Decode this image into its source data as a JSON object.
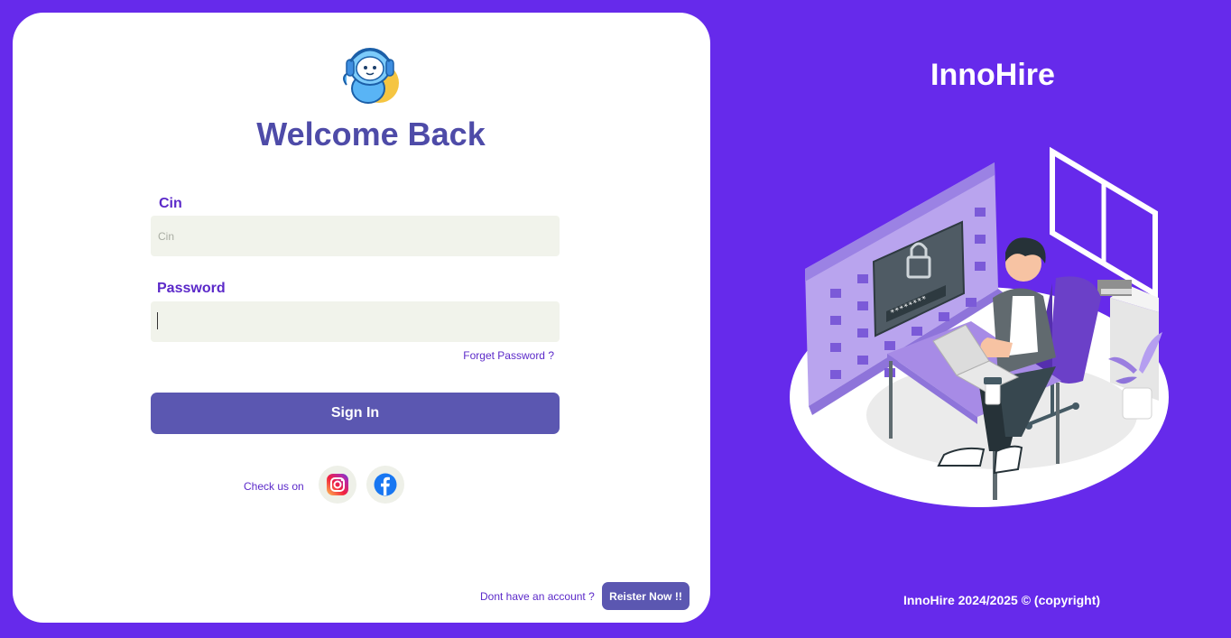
{
  "login": {
    "title": "Welcome Back",
    "cin_label": "Cin",
    "cin_placeholder": "Cin",
    "password_label": "Password",
    "password_value": "",
    "forget_password": "Forget Password ?",
    "sign_in": "Sign In",
    "check_us_on": "Check us on",
    "social_icons": [
      "instagram-icon",
      "facebook-icon"
    ],
    "no_account": "Dont have an account ?",
    "register": "Reister Now !!"
  },
  "hero": {
    "brand": "InnoHire",
    "footer": "InnoHire 2024/2025 © (copyright)"
  },
  "colors": {
    "background": "#662AEB",
    "accent": "#5B57B1",
    "title": "#4E4BA8",
    "label": "#5B29C9",
    "input_bg": "#F1F3EB"
  }
}
